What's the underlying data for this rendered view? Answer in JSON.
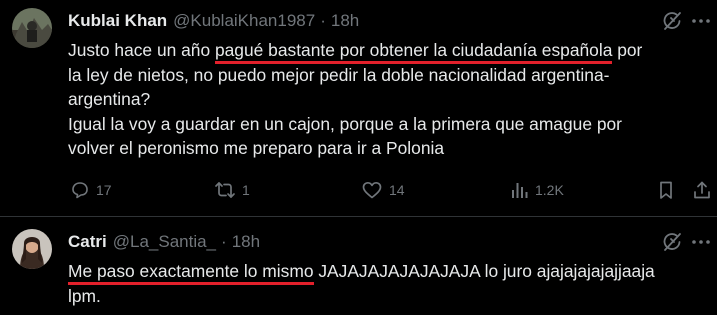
{
  "tweets": [
    {
      "author_name": "Kublai Khan",
      "handle": "@KublaiKhan1987",
      "separator": "·",
      "time": "18h",
      "lines": [
        {
          "pre": "Justo hace un año ",
          "ul": "pagué bastante por obtener la ciudadanía española",
          "post": " por"
        },
        {
          "text": "la ley de nietos, no puedo mejor pedir la doble nacionalidad argentina-"
        },
        {
          "text": "argentina?"
        },
        {
          "text": "Igual la voy a guardar en un cajon, porque a la primera que amague por"
        },
        {
          "text": "volver el peronismo me preparo para ir a Polonia"
        }
      ],
      "actions": {
        "replies": "17",
        "reposts": "1",
        "likes": "14",
        "views": "1.2K"
      },
      "icons": [
        "grok-icon",
        "more-icon",
        "reply-icon",
        "repost-icon",
        "like-icon",
        "views-icon",
        "bookmark-icon",
        "share-icon"
      ]
    },
    {
      "author_name": "Catri",
      "handle": "@La_Santia_",
      "separator": "·",
      "time": "18h",
      "lines": [
        {
          "ul": "Me paso exactamente lo mismo",
          "post": " JAJAJAJAJAJAJAJA lo juro ajajajajajajjaaja"
        },
        {
          "text": "lpm."
        }
      ],
      "icons": [
        "grok-icon",
        "more-icon"
      ]
    }
  ],
  "colors": {
    "background": "#000000",
    "text": "#e7e9ea",
    "secondary": "#71767b",
    "divider": "#2f3336",
    "underline": "#e3202b"
  }
}
